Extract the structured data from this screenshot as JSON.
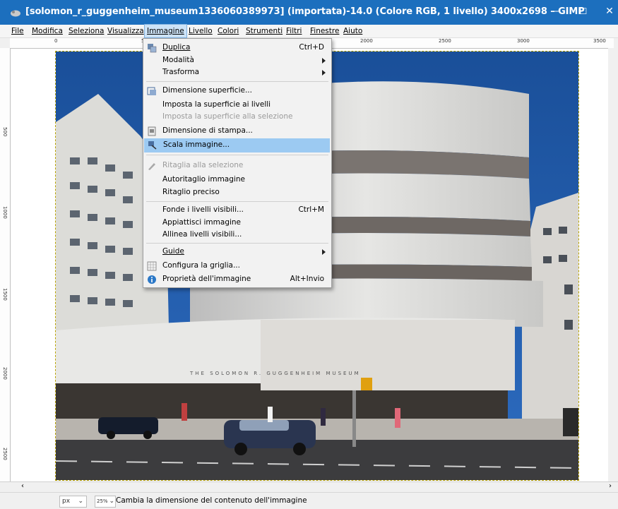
{
  "window": {
    "title": "[solomon_r_guggenheim_museum1336060389973] (importata)-14.0 (Colore RGB, 1 livello) 3400x2698 – GIMP",
    "minimize": "–",
    "maximize": "☐",
    "close": "✕"
  },
  "menubar": {
    "items": [
      "File",
      "Modifica",
      "Seleziona",
      "Visualizza",
      "Immagine",
      "Livello",
      "Colori",
      "Strumenti",
      "Filtri",
      "Finestre",
      "Aiuto"
    ]
  },
  "ruler": {
    "h_labels": [
      "0",
      "500",
      "2000",
      "2500",
      "3000",
      "3500"
    ],
    "v_labels": [
      "500",
      "1000",
      "1500",
      "2000",
      "2500"
    ]
  },
  "image_menu": {
    "items": [
      {
        "label": "Duplica",
        "shortcut": "Ctrl+D",
        "icon": "duplicate-icon"
      },
      {
        "label": "Modalità",
        "submenu": true
      },
      {
        "label": "Trasforma",
        "submenu": true
      },
      {
        "label": "Dimensione superficie...",
        "icon": "canvas-size-icon"
      },
      {
        "label": "Imposta la superficie ai livelli"
      },
      {
        "label": "Imposta la superficie alla selezione",
        "disabled": true
      },
      {
        "label": "Dimensione di stampa...",
        "icon": "print-size-icon"
      },
      {
        "label": "Scala immagine...",
        "icon": "scale-image-icon",
        "highlighted": true
      },
      {
        "label": "Ritaglia alla selezione",
        "icon": "crop-icon",
        "disabled": true
      },
      {
        "label": "Autoritaglio immagine"
      },
      {
        "label": "Ritaglio preciso"
      },
      {
        "label": "Fonde i livelli visibili...",
        "shortcut": "Ctrl+M"
      },
      {
        "label": "Appiattisci immagine"
      },
      {
        "label": "Allinea livelli visibili..."
      },
      {
        "label": "Guide",
        "submenu": true
      },
      {
        "label": "Configura la griglia...",
        "icon": "grid-icon"
      },
      {
        "label": "Proprietà dell'immagine",
        "shortcut": "Alt+Invio",
        "icon": "info-icon"
      }
    ]
  },
  "statusbar": {
    "unit": "px",
    "zoom": "25%",
    "message": "Cambia la dimensione del contenuto dell'immagine"
  },
  "colors": {
    "titlebar": "#1c6fbe",
    "menu_highlight": "#9ccaf2",
    "sky": "#1f5aa8"
  }
}
